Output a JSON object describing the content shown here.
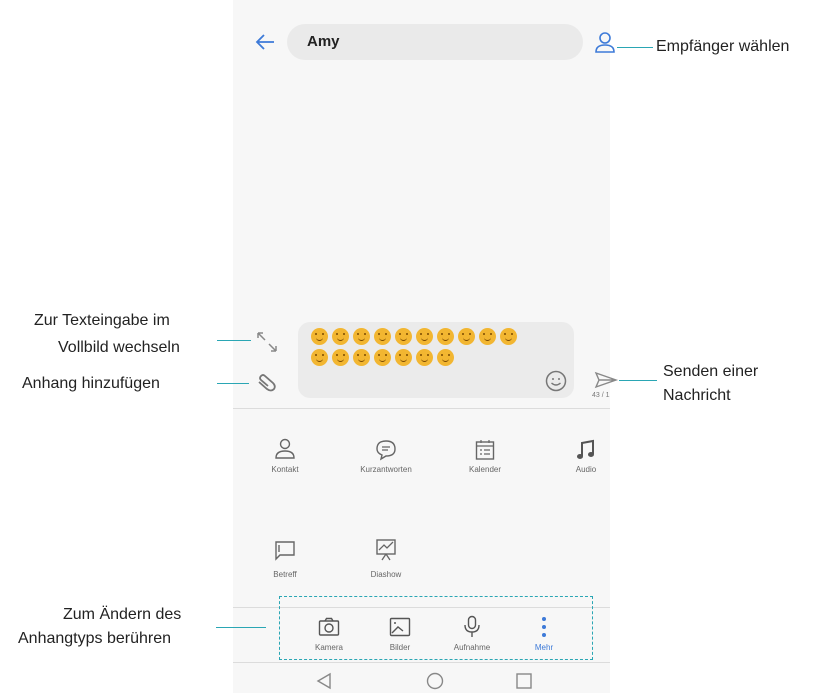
{
  "header": {
    "recipient_value": "Amy",
    "back_icon": "arrow-left-icon",
    "contact_icon": "person-icon"
  },
  "message": {
    "emoji_count_row1": 10,
    "emoji_count_row2": 7,
    "emoji_icon": "smiley-face-icon",
    "char_counter": "43 / 1"
  },
  "attachments": {
    "row1": [
      {
        "label": "Kontakt",
        "icon": "person-icon"
      },
      {
        "label": "Kurzantworten",
        "icon": "chat-bubble-icon"
      },
      {
        "label": "Kalender",
        "icon": "calendar-icon"
      },
      {
        "label": "Audio",
        "icon": "music-note-icon"
      }
    ],
    "row2": [
      {
        "label": "Betreff",
        "icon": "subject-icon"
      },
      {
        "label": "Diashow",
        "icon": "slideshow-icon"
      }
    ]
  },
  "tabs": [
    {
      "label": "Kamera",
      "icon": "camera-icon"
    },
    {
      "label": "Bilder",
      "icon": "image-icon"
    },
    {
      "label": "Aufnahme",
      "icon": "microphone-icon"
    },
    {
      "label": "Mehr",
      "icon": "more-vertical-icon"
    }
  ],
  "navbar": {
    "back": "triangle-back-icon",
    "home": "circle-home-icon",
    "recents": "square-recents-icon"
  },
  "callouts": {
    "recipient": "Empfänger wählen",
    "fullscreen_line1": "Zur Texteingabe im",
    "fullscreen_line2": "Vollbild wechseln",
    "attach": "Anhang hinzufügen",
    "send_line1": "Senden einer",
    "send_line2": "Nachricht",
    "type_line1": "Zum Ändern des",
    "type_line2": "Anhangtyps berühren"
  },
  "colors": {
    "accent": "#2aa6b4",
    "active_tab": "#3d7ad8"
  }
}
